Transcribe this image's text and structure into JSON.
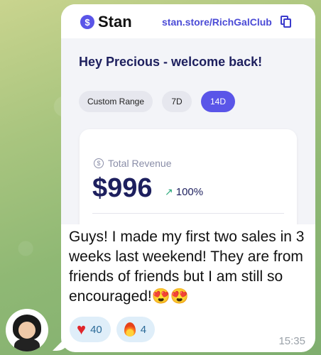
{
  "screenshot": {
    "brand": {
      "logo_glyph": "$",
      "name": "Stan"
    },
    "store_url": "stan.store/RichGalClub",
    "copy_icon": "copy-icon",
    "welcome": "Hey Precious - welcome back!",
    "ranges": [
      {
        "label": "Custom Range",
        "selected": false
      },
      {
        "label": "7D",
        "selected": false
      },
      {
        "label": "14D",
        "selected": true
      }
    ],
    "revenue": {
      "label": "Total Revenue",
      "value": "$996",
      "change": "100%",
      "trend_icon": "trend-up-icon"
    },
    "accent_color": "#5a55e8"
  },
  "message": {
    "text": "Guys! I made my first two sales in 3 weeks last weekend! They are from friends of friends but I am still so encouraged!😍😍",
    "time": "15:35",
    "reactions": [
      {
        "icon": "heart-icon",
        "count": "40"
      },
      {
        "icon": "fire-icon",
        "count": "4"
      }
    ]
  }
}
